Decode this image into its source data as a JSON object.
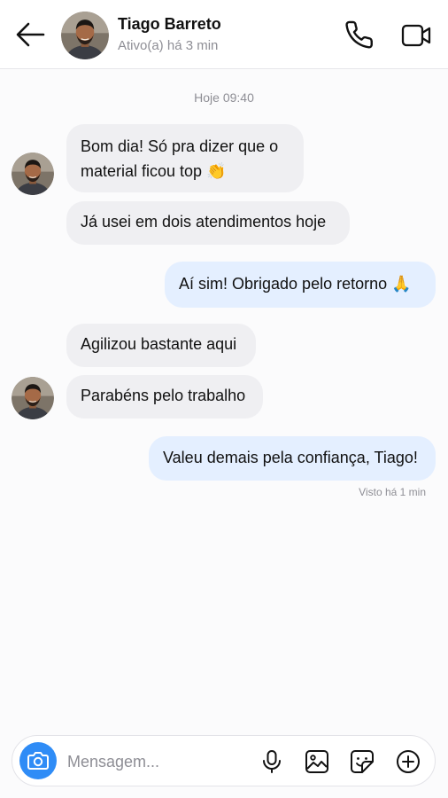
{
  "header": {
    "name": "Tiago Barreto",
    "status": "Ativo(a) há 3 min",
    "back_icon": "arrow-left-icon",
    "call_icon": "phone-icon",
    "video_icon": "video-camera-icon"
  },
  "conversation": {
    "timestamp": "Hoje 09:40",
    "messages": [
      {
        "direction": "in",
        "text_line1": "Bom dia! Só pra dizer que o",
        "text_line2": "material ficou top 👏"
      },
      {
        "direction": "in",
        "text": "Já usei em dois atendimentos hoje"
      },
      {
        "direction": "out",
        "text": "Aí sim! Obrigado pelo retorno 🙏"
      },
      {
        "direction": "in",
        "text": "Agilizou bastante aqui"
      },
      {
        "direction": "in",
        "text": "Parabéns pelo trabalho"
      },
      {
        "direction": "out",
        "text": "Valeu demais pela confiança, Tiago!"
      }
    ],
    "seen": "Visto há 1 min"
  },
  "composer": {
    "placeholder": "Mensagem...",
    "camera_icon": "camera-icon",
    "mic_icon": "microphone-icon",
    "gallery_icon": "image-icon",
    "sticker_icon": "sticker-icon",
    "add_icon": "plus-circle-icon"
  },
  "colors": {
    "accent": "#2f8cf6",
    "incoming_bubble": "#efeff2",
    "outgoing_bubble": "#e4efff",
    "muted_text": "#8e8e95"
  }
}
